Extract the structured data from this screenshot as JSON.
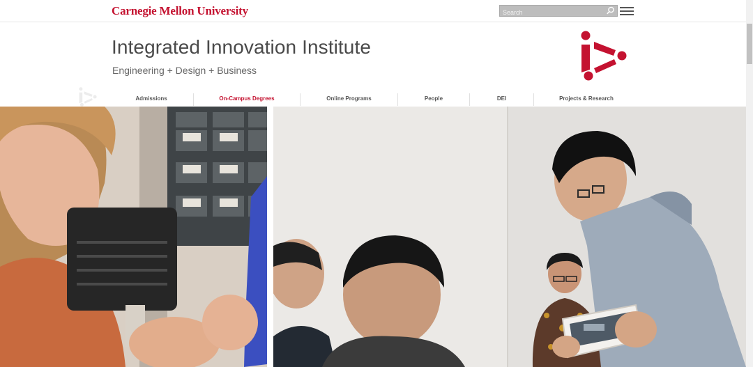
{
  "brand": {
    "wordmark": "Carnegie Mellon University",
    "accent_color": "#c41230"
  },
  "search": {
    "placeholder": "Search",
    "icon": "search-icon"
  },
  "menu": {
    "icon": "hamburger-menu-icon"
  },
  "header": {
    "title": "Integrated Innovation Institute",
    "subtitle": "Engineering + Design + Business",
    "logo_icon": "iii-play-logo-icon"
  },
  "nav": {
    "items": [
      {
        "label": "Admissions",
        "active": false
      },
      {
        "label": "On-Campus Degrees",
        "active": true
      },
      {
        "label": "Online Programs",
        "active": false
      },
      {
        "label": "People",
        "active": false
      },
      {
        "label": "DEI",
        "active": false
      },
      {
        "label": "Projects & Research",
        "active": false
      }
    ]
  },
  "hero": {
    "left_image": "photo-woman-soldering-in-lab",
    "right_image": "photo-student-presenting-tablet-to-group"
  }
}
